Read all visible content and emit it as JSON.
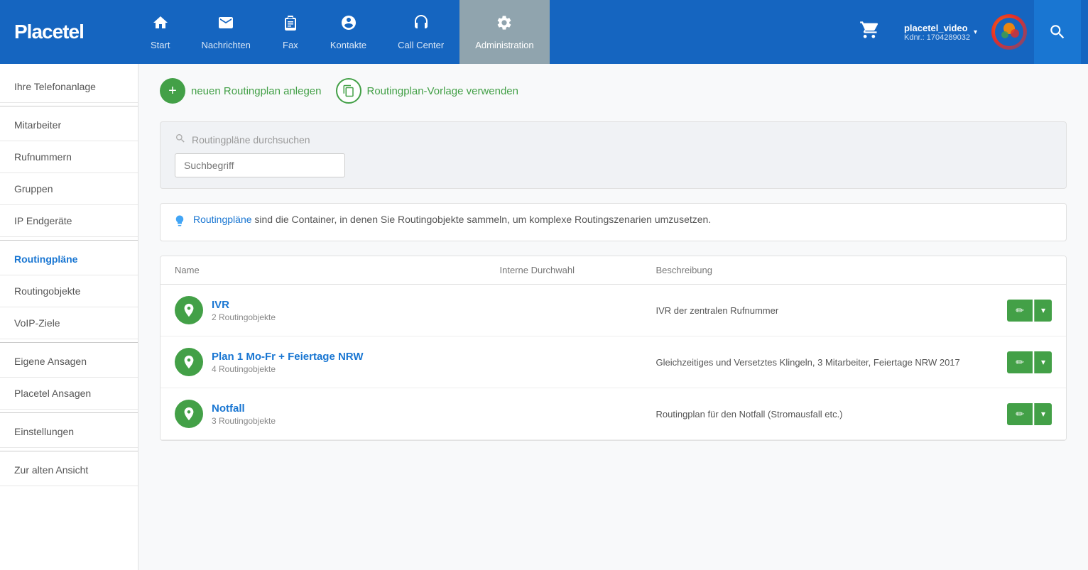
{
  "logo": {
    "text_plain": "Place",
    "text_bold": "tel"
  },
  "nav": {
    "items": [
      {
        "id": "start",
        "label": "Start",
        "icon": "⌂"
      },
      {
        "id": "nachrichten",
        "label": "Nachrichten",
        "icon": "✉"
      },
      {
        "id": "fax",
        "label": "Fax",
        "icon": "📄"
      },
      {
        "id": "kontakte",
        "label": "Kontakte",
        "icon": "👤"
      },
      {
        "id": "call-center",
        "label": "Call Center",
        "icon": "🎧"
      },
      {
        "id": "administration",
        "label": "Administration",
        "icon": "⚙",
        "active": true
      }
    ],
    "user": {
      "name": "placetel_video",
      "kdnr": "Kdnr.: 1704289032"
    }
  },
  "sidebar": {
    "items": [
      {
        "id": "telefonanlage",
        "label": "Ihre Telefonanlage",
        "active": false
      },
      {
        "id": "mitarbeiter",
        "label": "Mitarbeiter",
        "active": false
      },
      {
        "id": "rufnummern",
        "label": "Rufnummern",
        "active": false
      },
      {
        "id": "gruppen",
        "label": "Gruppen",
        "active": false
      },
      {
        "id": "ip-endgeraete",
        "label": "IP Endgeräte",
        "active": false
      },
      {
        "id": "routingplaene",
        "label": "Routingpläne",
        "active": true
      },
      {
        "id": "routingobjekte",
        "label": "Routingobjekte",
        "active": false
      },
      {
        "id": "voip-ziele",
        "label": "VoIP-Ziele",
        "active": false
      },
      {
        "id": "eigene-ansagen",
        "label": "Eigene Ansagen",
        "active": false
      },
      {
        "id": "placetel-ansagen",
        "label": "Placetel Ansagen",
        "active": false
      },
      {
        "id": "einstellungen",
        "label": "Einstellungen",
        "active": false
      },
      {
        "id": "zur-alten-ansicht",
        "label": "Zur alten Ansicht",
        "active": false
      }
    ]
  },
  "main": {
    "actions": {
      "new_routing_plan": "neuen Routingplan anlegen",
      "use_template": "Routingplan-Vorlage verwenden"
    },
    "search": {
      "label": "Routingpläne durchsuchen",
      "placeholder": "Suchbegriff"
    },
    "info": {
      "link_text": "Routingpläne",
      "description": " sind die Container, in denen Sie Routingobjekte sammeln, um komplexe Routingszenarien umzusetzen."
    },
    "table": {
      "headers": [
        "Name",
        "Interne Durchwahl",
        "Beschreibung",
        ""
      ],
      "rows": [
        {
          "id": "ivr",
          "name": "IVR",
          "sub": "2 Routingobjekte",
          "internal": "",
          "description": "IVR der zentralen Rufnummer"
        },
        {
          "id": "plan1",
          "name": "Plan 1 Mo-Fr + Feiertage NRW",
          "sub": "4 Routingobjekte",
          "internal": "",
          "description": "Gleichzeitiges und Versetztes Klingeln, 3 Mitarbeiter, Feiertage NRW 2017"
        },
        {
          "id": "notfall",
          "name": "Notfall",
          "sub": "3 Routingobjekte",
          "internal": "",
          "description": "Routingplan für den Notfall (Stromausfall etc.)"
        }
      ]
    }
  },
  "icons": {
    "search": "🔍",
    "plus": "+",
    "copy": "⎘",
    "bulb": "💡",
    "routing": "⚙",
    "edit": "✏",
    "chevron_down": "▾",
    "cart": "🛒"
  },
  "colors": {
    "nav_bg": "#1565c0",
    "nav_active": "#90a4ae",
    "green": "#43a047",
    "blue_link": "#1976d2"
  }
}
